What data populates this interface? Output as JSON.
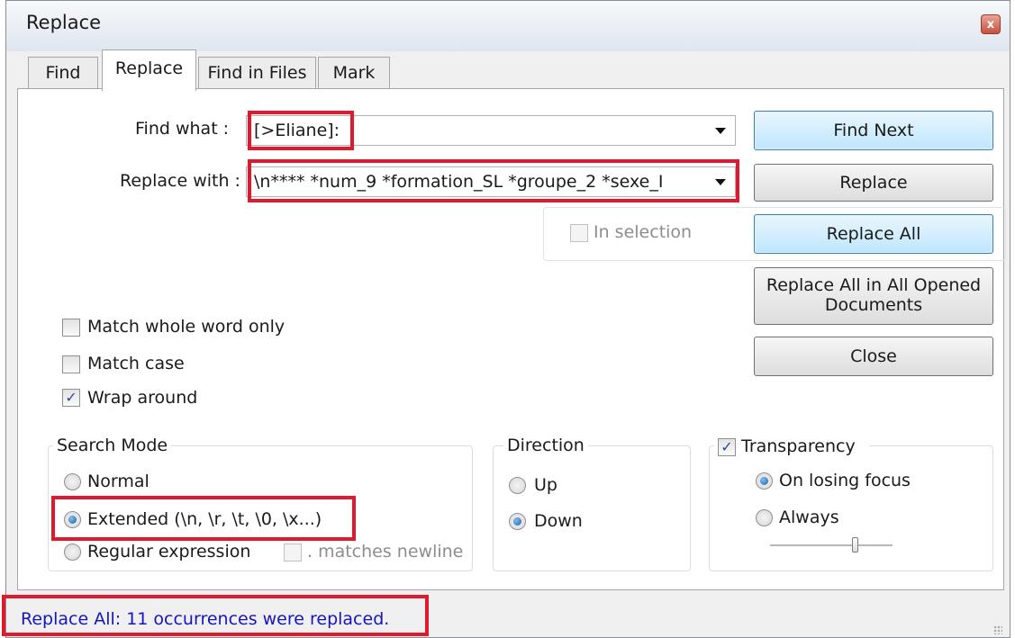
{
  "window": {
    "title": "Replace",
    "close_glyph": "x"
  },
  "tabs": [
    {
      "label": "Find"
    },
    {
      "label": "Replace"
    },
    {
      "label": "Find in Files"
    },
    {
      "label": "Mark"
    }
  ],
  "find_what": {
    "label": "Find what :",
    "value": "[>Eliane]:"
  },
  "replace_with": {
    "label": "Replace with :",
    "value": "\\n**** *num_9 *formation_SL *groupe_2 *sexe_I"
  },
  "in_selection": {
    "label": "In selection",
    "checked": false,
    "enabled": false
  },
  "buttons": {
    "find_next": "Find Next",
    "replace": "Replace",
    "replace_all": "Replace All",
    "replace_all_opened": "Replace All in All Opened Documents",
    "close": "Close"
  },
  "options": {
    "match_whole_word": {
      "label": "Match whole word only",
      "checked": false
    },
    "match_case": {
      "label": "Match case",
      "checked": false
    },
    "wrap_around": {
      "label": "Wrap around",
      "checked": true
    }
  },
  "search_mode": {
    "title": "Search Mode",
    "normal": "Normal",
    "extended": "Extended (\\n, \\r, \\t, \\0, \\x...)",
    "regex": "Regular expression",
    "matches_newline": ". matches newline",
    "selected": "extended"
  },
  "direction": {
    "title": "Direction",
    "up": "Up",
    "down": "Down",
    "selected": "down"
  },
  "transparency": {
    "title": "Transparency",
    "checked": true,
    "on_losing_focus": "On losing focus",
    "always": "Always",
    "selected": "on_losing_focus"
  },
  "status": {
    "message": "Replace All: 11 occurrences were replaced."
  },
  "colors": {
    "highlight_red": "#e01a2c",
    "status_blue": "#1515c4",
    "button_blue": "#bee6fd"
  }
}
